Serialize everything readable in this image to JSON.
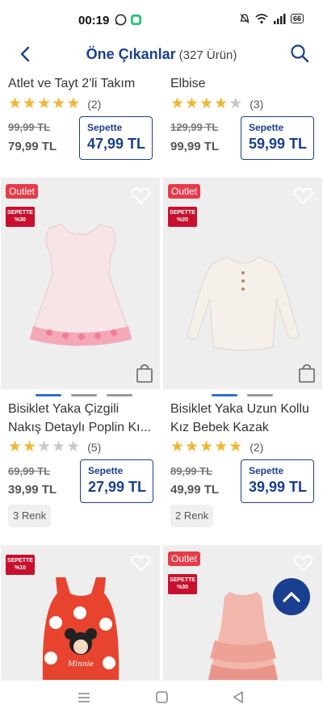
{
  "status_bar": {
    "time": "00:19",
    "battery": "66"
  },
  "header": {
    "title": "Öne Çıkanlar",
    "count": "(327 Ürün)"
  },
  "basket_label": "Sepette",
  "products_top": [
    {
      "name": "Atlet ve Tayt 2'li Takım",
      "rating": 5,
      "reviews": "(2)",
      "old_price": "99,99 TL",
      "price": "79,99 TL",
      "basket_price": "47,99 TL"
    },
    {
      "name": "Elbise",
      "rating": 4,
      "reviews": "(3)",
      "old_price": "129,99 TL",
      "price": "99,99 TL",
      "basket_price": "59,99 TL"
    }
  ],
  "products_mid": [
    {
      "outlet": "Outlet",
      "badge": [
        "SEPETTE",
        "%30"
      ],
      "name_line1": "Bisiklet Yaka Çizgili",
      "name_line2": "Nakış Detaylı Poplin Kı...",
      "rating": 2,
      "reviews": "(5)",
      "old_price": "69,99 TL",
      "price": "39,99 TL",
      "basket_price": "27,99 TL",
      "colors": "3 Renk"
    },
    {
      "outlet": "Outlet",
      "badge": [
        "SEPETTE",
        "%20"
      ],
      "name_line1": "Bisiklet Yaka Uzun Kollu",
      "name_line2": "Kız Bebek Kazak",
      "rating": 5,
      "reviews": "(2)",
      "old_price": "89,99 TL",
      "price": "49,99 TL",
      "basket_price": "39,99 TL",
      "colors": "2 Renk"
    }
  ],
  "products_bottom": [
    {
      "badge": [
        "SEPETTE",
        "%10"
      ],
      "figure_text": "Minnie"
    },
    {
      "outlet": "Outlet",
      "badge": [
        "SEPETTE",
        "%30"
      ]
    }
  ],
  "colors": {
    "brand_blue": "#1b3f8f",
    "outlet_red": "#e63b4a",
    "star_gold": "#f2b634"
  }
}
